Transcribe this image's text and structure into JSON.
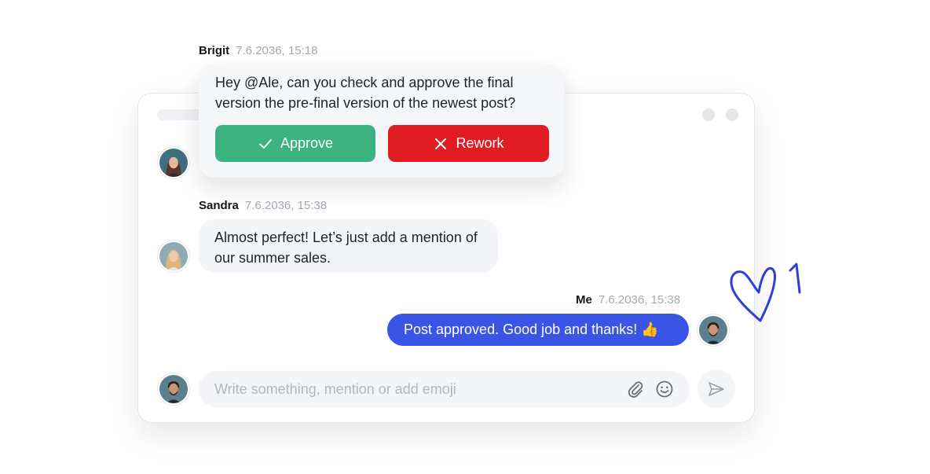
{
  "messages": [
    {
      "author": "Brigit",
      "time": "7.6.2036, 15:18",
      "text": "Hey @Ale, can you check and approve the final version the pre-final version of the newest post?",
      "actions": {
        "approve": "Approve",
        "rework": "Rework"
      }
    },
    {
      "author": "Sandra",
      "time": "7.6.2036, 15:38",
      "text": "Almost perfect! Let’s just add a mention of our summer sales."
    },
    {
      "author": "Me",
      "time": "7.6.2036, 15:38",
      "text": "Post approved. Good job and thanks! 👍"
    }
  ],
  "composer": {
    "placeholder": "Write something, mention or add emoji"
  },
  "icons": {
    "approve": "check-icon",
    "rework": "x-icon",
    "attach": "paperclip-icon",
    "emoji": "smiley-icon",
    "send": "send-icon"
  },
  "colors": {
    "approve": "#3bb37f",
    "rework": "#e21c23",
    "my_bubble": "#3a54e6",
    "doodle": "#2d3fd8"
  }
}
